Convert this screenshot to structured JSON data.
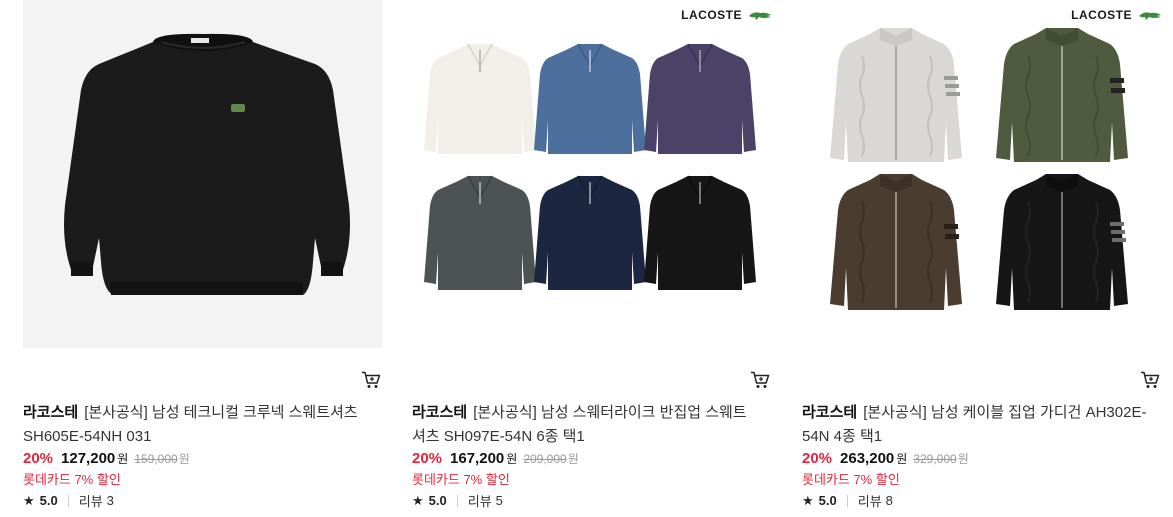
{
  "products": [
    {
      "brand": "라코스테",
      "name": "[본사공식] 남성 테크니컬 크루넥 스웨트셔츠 SH605E-54NH 031",
      "discount": "20%",
      "price": "127,200",
      "price_unit": "원",
      "original_price": "159,000",
      "original_unit": "원",
      "card_promo": "롯데카드 7% 할인",
      "rating": "5.0",
      "review_label": "리뷰",
      "review_count": "3",
      "logo_text": ""
    },
    {
      "brand": "라코스테",
      "name": "[본사공식] 남성 스웨터라이크 반집업 스웨트셔츠 SH097E-54N 6종 택1",
      "discount": "20%",
      "price": "167,200",
      "price_unit": "원",
      "original_price": "209,000",
      "original_unit": "원",
      "card_promo": "롯데카드 7% 할인",
      "rating": "5.0",
      "review_label": "리뷰",
      "review_count": "5",
      "logo_text": "LACOSTE"
    },
    {
      "brand": "라코스테",
      "name": "[본사공식] 남성 케이블 집업 가디건 AH302E-54N 4종 택1",
      "discount": "20%",
      "price": "263,200",
      "price_unit": "원",
      "original_price": "329,000",
      "original_unit": "원",
      "card_promo": "롯데카드 7% 할인",
      "rating": "5.0",
      "review_label": "리뷰",
      "review_count": "8",
      "logo_text": "LACOSTE"
    }
  ],
  "icons": {
    "cart": "cart-icon",
    "star": "star-icon",
    "logo": "crocodile-icon"
  },
  "colors": {
    "discount": "#e8243c",
    "promo": "#e8243c",
    "sweater_black": "#1b1b1b",
    "ivory": "#f2efe8",
    "blue": "#4d6f9e",
    "purple": "#4b4268",
    "gray": "#4c5352",
    "navy": "#1d2640",
    "cable_gray": "#d9d8d4",
    "olive": "#4f5a3e",
    "brown": "#4a3c2e"
  }
}
